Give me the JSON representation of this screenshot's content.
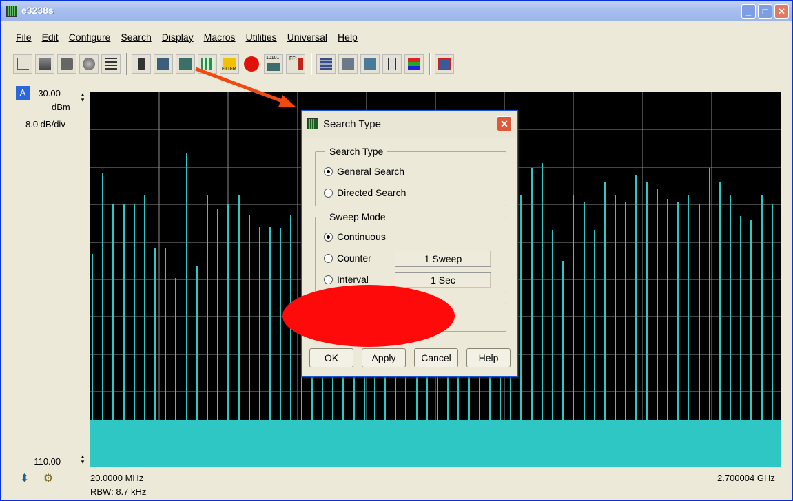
{
  "window": {
    "title": "e3238s",
    "minimize": "_",
    "maximize": "□",
    "close": "✕"
  },
  "menu": [
    "File",
    "Edit",
    "Configure",
    "Search",
    "Display",
    "Macros",
    "Utilities",
    "Universal",
    "Help"
  ],
  "toolbar_icons": [
    "marker-tool-icon",
    "cube-icon",
    "device-icon",
    "globe-icon",
    "list-icon",
    "traffic-light-icon",
    "spectrum-icon",
    "spectrum-f1f2-icon",
    "grid-icon",
    "filter-icon",
    "record-icon",
    "binary-icon",
    "ff-icon",
    "panel-icon",
    "display-icon",
    "window-icon",
    "probe-icon",
    "bars-icon",
    "connector-icon"
  ],
  "toolbar_labels": {
    "filter": "FILTER",
    "binary": "1010..",
    "ff": "FFt"
  },
  "trace": {
    "badge": "A",
    "ref_level": "-30.00",
    "ref_unit": "dBm",
    "scale": "8.0 dB/div",
    "bottom_level": "-110.00",
    "start_freq": "20.0000 MHz",
    "rbw": "RBW: 8.7 kHz",
    "stop_freq": "2.700004 GHz",
    "trace_color": "#2fc7c4",
    "background": "#000000"
  },
  "dialog": {
    "title": "Search Type",
    "search_type_group": "Search Type",
    "general_search": "General Search",
    "directed_search": "Directed Search",
    "sweep_mode_group": "Sweep Mode",
    "continuous": "Continuous",
    "counter": "Counter",
    "counter_value": "1 Sweep",
    "interval": "Interval",
    "interval_value": "1 Sec",
    "ok": "OK",
    "apply": "Apply",
    "cancel": "Cancel",
    "help": "Help"
  }
}
